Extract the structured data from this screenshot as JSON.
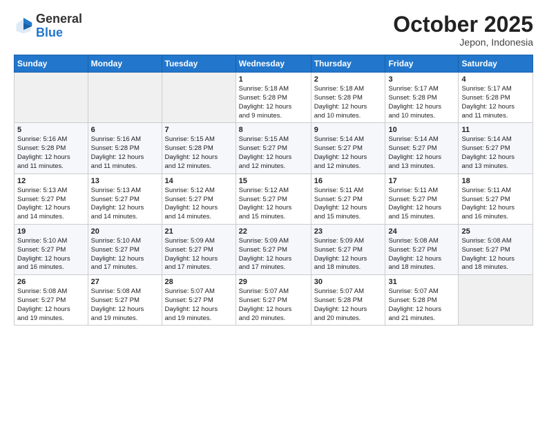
{
  "header": {
    "logo_general": "General",
    "logo_blue": "Blue",
    "month": "October 2025",
    "location": "Jepon, Indonesia"
  },
  "days_of_week": [
    "Sunday",
    "Monday",
    "Tuesday",
    "Wednesday",
    "Thursday",
    "Friday",
    "Saturday"
  ],
  "weeks": [
    [
      {
        "date": "",
        "info": ""
      },
      {
        "date": "",
        "info": ""
      },
      {
        "date": "",
        "info": ""
      },
      {
        "date": "1",
        "info": "Sunrise: 5:18 AM\nSunset: 5:28 PM\nDaylight: 12 hours\nand 9 minutes."
      },
      {
        "date": "2",
        "info": "Sunrise: 5:18 AM\nSunset: 5:28 PM\nDaylight: 12 hours\nand 10 minutes."
      },
      {
        "date": "3",
        "info": "Sunrise: 5:17 AM\nSunset: 5:28 PM\nDaylight: 12 hours\nand 10 minutes."
      },
      {
        "date": "4",
        "info": "Sunrise: 5:17 AM\nSunset: 5:28 PM\nDaylight: 12 hours\nand 11 minutes."
      }
    ],
    [
      {
        "date": "5",
        "info": "Sunrise: 5:16 AM\nSunset: 5:28 PM\nDaylight: 12 hours\nand 11 minutes."
      },
      {
        "date": "6",
        "info": "Sunrise: 5:16 AM\nSunset: 5:28 PM\nDaylight: 12 hours\nand 11 minutes."
      },
      {
        "date": "7",
        "info": "Sunrise: 5:15 AM\nSunset: 5:28 PM\nDaylight: 12 hours\nand 12 minutes."
      },
      {
        "date": "8",
        "info": "Sunrise: 5:15 AM\nSunset: 5:27 PM\nDaylight: 12 hours\nand 12 minutes."
      },
      {
        "date": "9",
        "info": "Sunrise: 5:14 AM\nSunset: 5:27 PM\nDaylight: 12 hours\nand 12 minutes."
      },
      {
        "date": "10",
        "info": "Sunrise: 5:14 AM\nSunset: 5:27 PM\nDaylight: 12 hours\nand 13 minutes."
      },
      {
        "date": "11",
        "info": "Sunrise: 5:14 AM\nSunset: 5:27 PM\nDaylight: 12 hours\nand 13 minutes."
      }
    ],
    [
      {
        "date": "12",
        "info": "Sunrise: 5:13 AM\nSunset: 5:27 PM\nDaylight: 12 hours\nand 14 minutes."
      },
      {
        "date": "13",
        "info": "Sunrise: 5:13 AM\nSunset: 5:27 PM\nDaylight: 12 hours\nand 14 minutes."
      },
      {
        "date": "14",
        "info": "Sunrise: 5:12 AM\nSunset: 5:27 PM\nDaylight: 12 hours\nand 14 minutes."
      },
      {
        "date": "15",
        "info": "Sunrise: 5:12 AM\nSunset: 5:27 PM\nDaylight: 12 hours\nand 15 minutes."
      },
      {
        "date": "16",
        "info": "Sunrise: 5:11 AM\nSunset: 5:27 PM\nDaylight: 12 hours\nand 15 minutes."
      },
      {
        "date": "17",
        "info": "Sunrise: 5:11 AM\nSunset: 5:27 PM\nDaylight: 12 hours\nand 15 minutes."
      },
      {
        "date": "18",
        "info": "Sunrise: 5:11 AM\nSunset: 5:27 PM\nDaylight: 12 hours\nand 16 minutes."
      }
    ],
    [
      {
        "date": "19",
        "info": "Sunrise: 5:10 AM\nSunset: 5:27 PM\nDaylight: 12 hours\nand 16 minutes."
      },
      {
        "date": "20",
        "info": "Sunrise: 5:10 AM\nSunset: 5:27 PM\nDaylight: 12 hours\nand 17 minutes."
      },
      {
        "date": "21",
        "info": "Sunrise: 5:09 AM\nSunset: 5:27 PM\nDaylight: 12 hours\nand 17 minutes."
      },
      {
        "date": "22",
        "info": "Sunrise: 5:09 AM\nSunset: 5:27 PM\nDaylight: 12 hours\nand 17 minutes."
      },
      {
        "date": "23",
        "info": "Sunrise: 5:09 AM\nSunset: 5:27 PM\nDaylight: 12 hours\nand 18 minutes."
      },
      {
        "date": "24",
        "info": "Sunrise: 5:08 AM\nSunset: 5:27 PM\nDaylight: 12 hours\nand 18 minutes."
      },
      {
        "date": "25",
        "info": "Sunrise: 5:08 AM\nSunset: 5:27 PM\nDaylight: 12 hours\nand 18 minutes."
      }
    ],
    [
      {
        "date": "26",
        "info": "Sunrise: 5:08 AM\nSunset: 5:27 PM\nDaylight: 12 hours\nand 19 minutes."
      },
      {
        "date": "27",
        "info": "Sunrise: 5:08 AM\nSunset: 5:27 PM\nDaylight: 12 hours\nand 19 minutes."
      },
      {
        "date": "28",
        "info": "Sunrise: 5:07 AM\nSunset: 5:27 PM\nDaylight: 12 hours\nand 19 minutes."
      },
      {
        "date": "29",
        "info": "Sunrise: 5:07 AM\nSunset: 5:27 PM\nDaylight: 12 hours\nand 20 minutes."
      },
      {
        "date": "30",
        "info": "Sunrise: 5:07 AM\nSunset: 5:28 PM\nDaylight: 12 hours\nand 20 minutes."
      },
      {
        "date": "31",
        "info": "Sunrise: 5:07 AM\nSunset: 5:28 PM\nDaylight: 12 hours\nand 21 minutes."
      },
      {
        "date": "",
        "info": ""
      }
    ]
  ]
}
